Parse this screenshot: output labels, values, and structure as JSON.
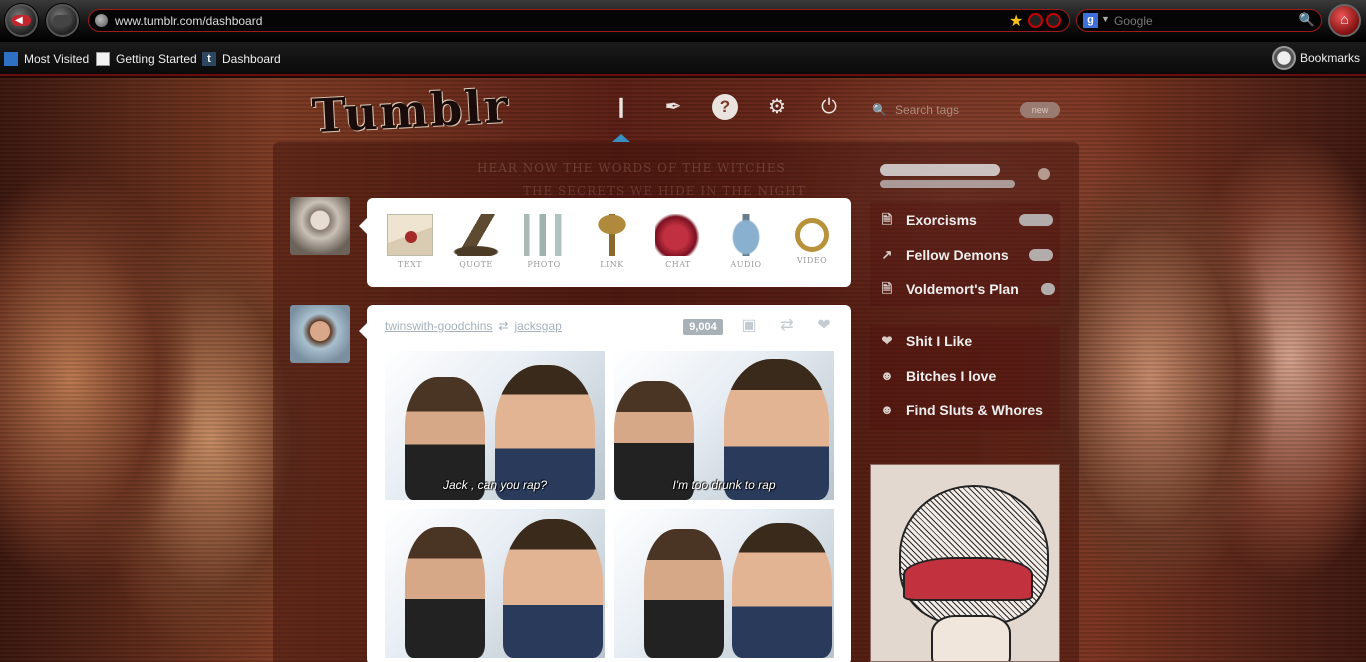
{
  "browser": {
    "url": "www.tumblr.com/dashboard",
    "search_placeholder": "Google",
    "bookmarks": [
      "Most Visited",
      "Getting Started",
      "Dashboard"
    ],
    "bookmarks_menu": "Bookmarks"
  },
  "tumblr": {
    "logo": "Tumblr",
    "search_tags_placeholder": "Search tags",
    "search_button": "new",
    "faint_header_1": "HEAR NOW THE WORDS OF THE WITCHES",
    "faint_header_2": "THE SECRETS WE HIDE IN THE NIGHT",
    "post_types": [
      "TEXT",
      "QUOTE",
      "PHOTO",
      "LINK",
      "CHAT",
      "AUDIO",
      "VIDEO"
    ],
    "post": {
      "reblogger": "twinswith-goodchins",
      "source": "jacksgap",
      "notes": "9,004",
      "captions": [
        "Jack , can you rap?",
        "I'm too drunk to rap",
        "",
        ""
      ]
    },
    "sidebar": {
      "blog_items": [
        "Exorcisms",
        "Fellow Demons",
        "Voldemort's Plan"
      ],
      "nav_items": [
        "Shit I Like",
        "Bitches I love",
        "Find Sluts & Whores"
      ]
    }
  },
  "icon_names": [
    "back-arrow-icon",
    "forward-arrow-icon",
    "home-icon",
    "globe-icon",
    "star-icon",
    "magnifier-icon",
    "dashboard-icon",
    "feather-icon",
    "help-icon",
    "gear-icon",
    "power-icon",
    "camera-icon",
    "reblog-icon",
    "heart-icon",
    "page-icon",
    "chart-icon",
    "user-icon",
    "clock-icon"
  ],
  "colors": {
    "accent_red": "#c1272d",
    "post_meta": "#a7b2bd",
    "dashboard_indicator": "#3a8fc2"
  }
}
